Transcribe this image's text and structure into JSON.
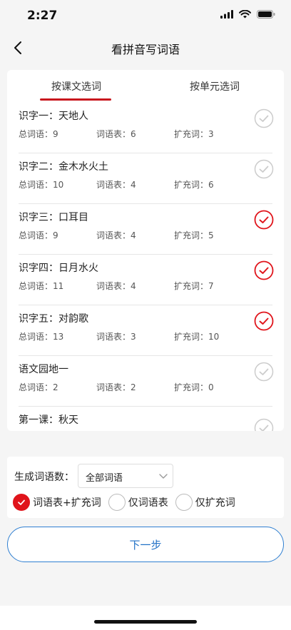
{
  "status": {
    "time": "2:27"
  },
  "nav": {
    "title": "看拼音写词语"
  },
  "tabs": [
    {
      "label": "按课文选词",
      "active": true
    },
    {
      "label": "按单元选词",
      "active": false
    }
  ],
  "lessons": [
    {
      "title": "识字一：天地人",
      "total": "总词语：9",
      "table": "词语表：6",
      "extra": "扩充词：3",
      "selected": false
    },
    {
      "title": "识字二：金木水火土",
      "total": "总词语：10",
      "table": "词语表：4",
      "extra": "扩充词：6",
      "selected": false
    },
    {
      "title": "识字三：口耳目",
      "total": "总词语：9",
      "table": "词语表：4",
      "extra": "扩充词：5",
      "selected": true
    },
    {
      "title": "识字四：日月水火",
      "total": "总词语：11",
      "table": "词语表：4",
      "extra": "扩充词：7",
      "selected": true
    },
    {
      "title": "识字五：对韵歌",
      "total": "总词语：13",
      "table": "词语表：3",
      "extra": "扩充词：10",
      "selected": true
    },
    {
      "title": "语文园地一",
      "total": "总词语：2",
      "table": "词语表：2",
      "extra": "扩充词：0",
      "selected": false
    },
    {
      "title": "第一课：秋天",
      "selected": false
    }
  ],
  "generator": {
    "label": "生成词语数：",
    "select_value": "全部词语",
    "options": [
      {
        "label": "词语表+扩充词",
        "selected": true
      },
      {
        "label": "仅词语表",
        "selected": false
      },
      {
        "label": "仅扩充词",
        "selected": false
      }
    ]
  },
  "next_button": {
    "label": "下一步"
  },
  "colors": {
    "accent": "#e0141b",
    "link": "#1f6fc5",
    "check_inactive": "#cccccc"
  },
  "icons": {
    "back": "chevron-left-icon",
    "check": "check-circle-icon",
    "dropdown": "chevron-down-icon"
  }
}
